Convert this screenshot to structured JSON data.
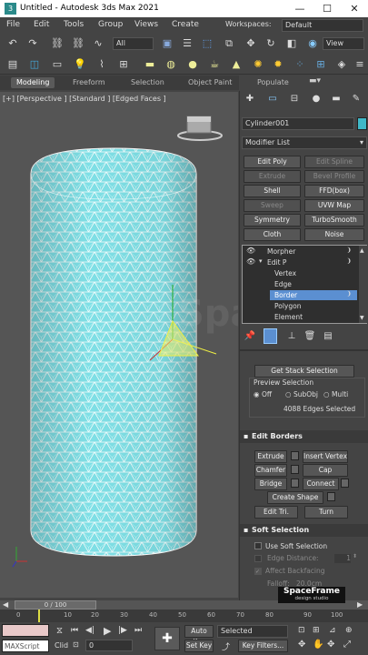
{
  "window": {
    "title": "Untitled - Autodesk 3ds Max 2021",
    "minimize": "—",
    "maximize": "☐",
    "close": "✕"
  },
  "menu": {
    "items": [
      "File",
      "Edit",
      "Tools",
      "Group",
      "Views",
      "Create"
    ],
    "workspaces_label": "Workspaces:",
    "workspaces_value": "Default"
  },
  "toolbar": {
    "selection_filter": "All",
    "view_dropdown": "View"
  },
  "ribbon": {
    "tabs": [
      "Modeling",
      "Freeform",
      "Selection",
      "Object Paint",
      "Populate"
    ],
    "active": "Modeling"
  },
  "viewport": {
    "label": "[+] [Perspective ] [Standard ] [Edged Faces ]",
    "object_color": "#7fe0e6",
    "watermark": "SpaceFrame",
    "watermark_sub": "design studio"
  },
  "command_panel": {
    "object_name": "Cylinder001",
    "object_color": "#3fb8c8",
    "modifier_list": "Modifier List",
    "modifier_buttons": [
      {
        "label": "Edit Poly",
        "enabled": true
      },
      {
        "label": "Edit Spline",
        "enabled": false
      },
      {
        "label": "Extrude",
        "enabled": false
      },
      {
        "label": "Bevel Profile",
        "enabled": false
      },
      {
        "label": "Shell",
        "enabled": true
      },
      {
        "label": "FFD(box)",
        "enabled": true
      },
      {
        "label": "Sweep",
        "enabled": false
      },
      {
        "label": "UVW Map",
        "enabled": true
      },
      {
        "label": "Symmetry",
        "enabled": true
      },
      {
        "label": "TurboSmooth",
        "enabled": true
      },
      {
        "label": "Cloth",
        "enabled": true
      },
      {
        "label": "Noise",
        "enabled": true
      }
    ],
    "stack": {
      "morpher": "Morpher",
      "edit_poly": "Edit P",
      "subobjects": [
        "Vertex",
        "Edge",
        "Border",
        "Polygon",
        "Element"
      ],
      "selected": "Border"
    },
    "selection": {
      "get_stack": "Get Stack Selection",
      "preview_label": "Preview Selection",
      "preview_options": [
        "Off",
        "SubObj",
        "Multi"
      ],
      "preview_selected": "Off",
      "status": "4088 Edges Selected"
    },
    "edit_borders": {
      "title": "Edit Borders",
      "buttons": [
        "Extrude",
        "Insert Vertex",
        "Chamfer",
        "Cap",
        "Bridge",
        "Connect",
        "Create Shape",
        "Edit Tri.",
        "Turn"
      ]
    },
    "soft_selection": {
      "title": "Soft Selection",
      "use_soft": "Use Soft Selection",
      "edge_distance": "Edge Distance:",
      "edge_distance_value": "1",
      "affect_backfacing": "Affect Backfacing",
      "falloff_label": "Falloff:",
      "falloff_value": "20.0cm"
    }
  },
  "timeline": {
    "frame": "0 / 100",
    "ticks": [
      "0",
      "10",
      "20",
      "30",
      "40",
      "50",
      "60",
      "70",
      "80",
      "90",
      "100"
    ]
  },
  "status": {
    "maxscript": "MAXScript",
    "click": "Clid",
    "frame_value": "0",
    "auto_key": "Auto Key",
    "selected": "Selected",
    "set_key": "Set Key",
    "key_filters": "Key Filters..."
  }
}
